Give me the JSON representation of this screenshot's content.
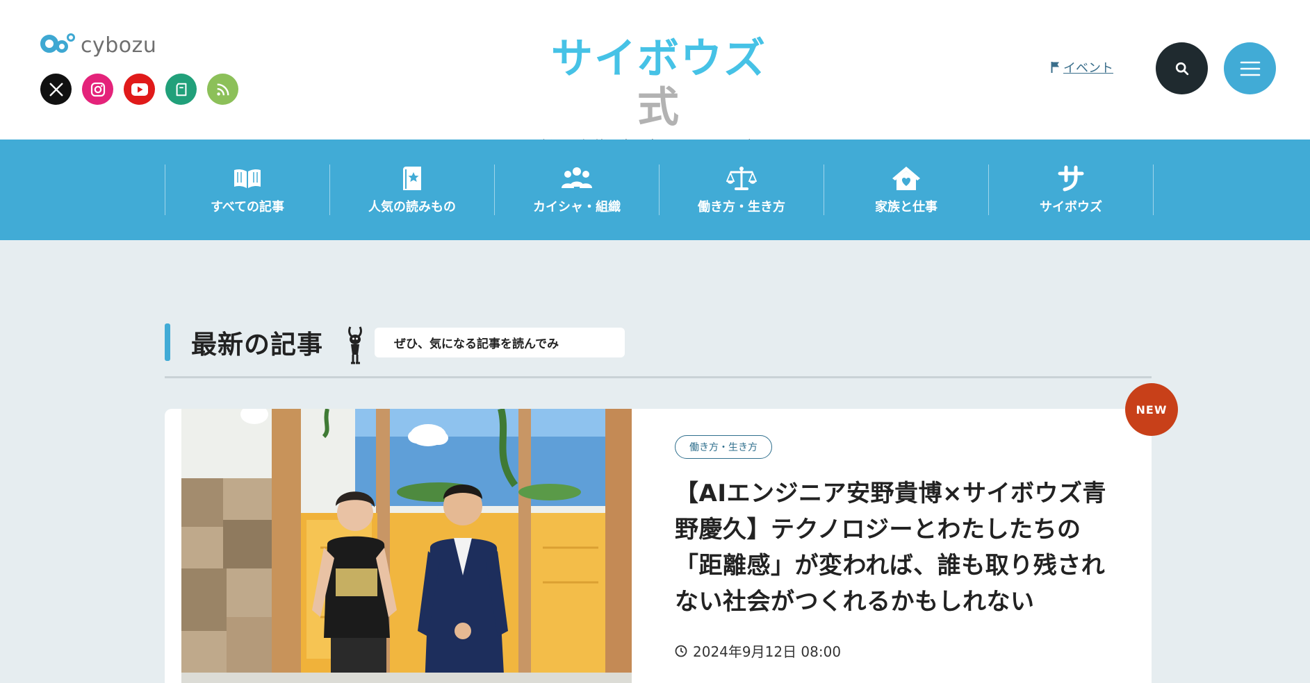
{
  "header": {
    "cybozu_logo_text": "cybozu",
    "brand_title_main": "サイボウズ",
    "brand_title_suffix": "式",
    "brand_subtitle": "新しい価値を生み出すチームのメディア",
    "event_link": "イベント",
    "social": [
      {
        "name": "x-icon",
        "color": "#111111"
      },
      {
        "name": "instagram-icon",
        "color": "#e4237a"
      },
      {
        "name": "youtube-icon",
        "color": "#e01a1a"
      },
      {
        "name": "note-icon",
        "color": "#21a07a"
      },
      {
        "name": "rss-icon",
        "color": "#8cc059"
      }
    ]
  },
  "nav": {
    "items": [
      {
        "label": "すべての記事",
        "icon": "open-book-icon"
      },
      {
        "label": "人気の読みもの",
        "icon": "star-book-icon"
      },
      {
        "label": "カイシャ・組織",
        "icon": "people-group-icon"
      },
      {
        "label": "働き方・生き方",
        "icon": "balance-scale-icon"
      },
      {
        "label": "家族と仕事",
        "icon": "heart-house-icon"
      },
      {
        "label": "サイボウズ",
        "icon": "sa-glyph-icon"
      }
    ]
  },
  "latest": {
    "title": "最新の記事",
    "speech": "ぜひ、気になる記事を読んでみ"
  },
  "article": {
    "badge": "NEW",
    "tag": "働き方・生き方",
    "title": "【AIエンジニア安野貴博×サイボウズ青野慶久】テクノロジーとわたしたちの「距離感」が変われば、誰も取り残されない社会がつくれるかもしれない",
    "date": "2024年9月12日 08:00"
  },
  "colors": {
    "accent": "#41abd6",
    "brand": "#46c2e6",
    "new_badge": "#c84019",
    "background": "#e6edf0"
  }
}
